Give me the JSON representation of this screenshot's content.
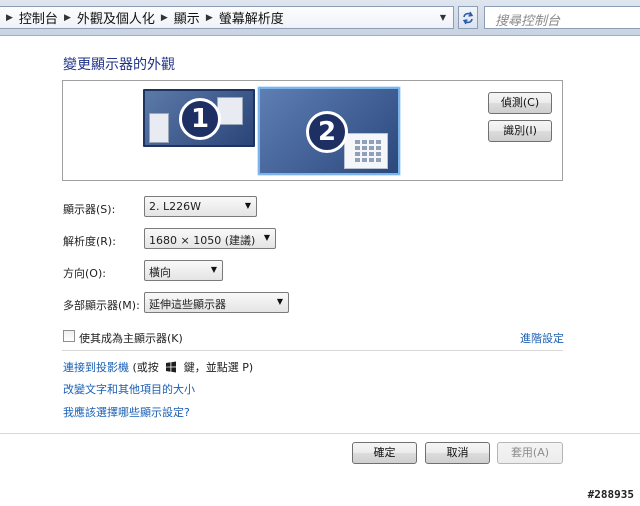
{
  "address_bar": {
    "crumbs": [
      "控制台",
      "外觀及個人化",
      "顯示",
      "螢幕解析度"
    ],
    "search_placeholder": "搜尋控制台"
  },
  "main": {
    "heading": "變更顯示器的外觀",
    "detect_button": "偵測(C)",
    "identify_button": "識別(I)",
    "monitors": [
      {
        "number": "1",
        "selected": false
      },
      {
        "number": "2",
        "selected": true
      }
    ],
    "fields": {
      "display": {
        "label": "顯示器(S):",
        "value": "2. L226W"
      },
      "resolution": {
        "label": "解析度(R):",
        "value": "1680 × 1050 (建議)"
      },
      "orientation": {
        "label": "方向(O):",
        "value": "橫向"
      },
      "multiple": {
        "label": "多部顯示器(M):",
        "value": "延伸這些顯示器"
      }
    },
    "main_display_checkbox": {
      "label": "使其成為主顯示器(K)",
      "checked": false
    },
    "advanced_link": "進階設定",
    "links": {
      "projector_prefix": "連接到投影機",
      "projector_suffix_a": "(或按",
      "projector_suffix_b": "鍵，並點選 P)",
      "text_size": "改變文字和其他項目的大小",
      "which_settings": "我應該選擇哪些顯示設定?"
    },
    "buttons": {
      "ok": "確定",
      "cancel": "取消",
      "apply": "套用(A)"
    }
  },
  "watermark": "#288935",
  "colors": {
    "link": "#1a5fb4",
    "heading": "#1e3287",
    "selected_monitor_border": "#7ab4ec"
  }
}
